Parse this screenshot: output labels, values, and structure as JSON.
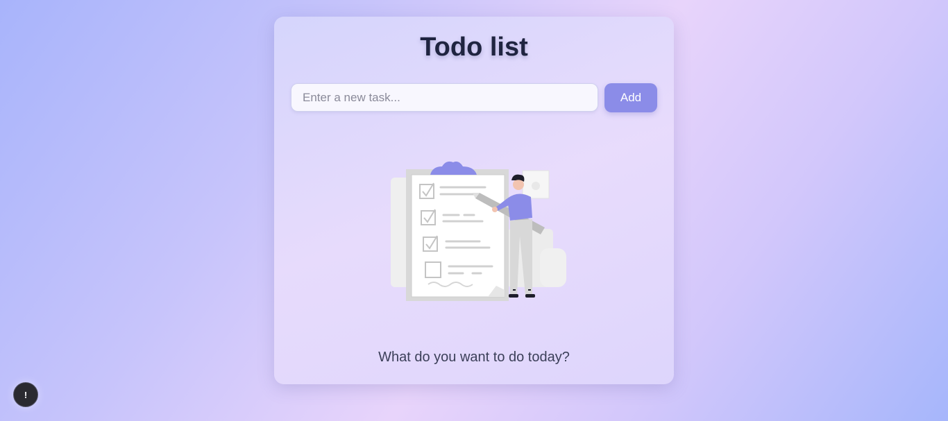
{
  "app": {
    "title": "Todo list"
  },
  "input": {
    "placeholder": "Enter a new task...",
    "value": ""
  },
  "add_button": {
    "label": "Add"
  },
  "empty_state": {
    "message": "What do you want to do today?",
    "illustration": "checklist-person-illustration"
  },
  "alert_badge": {
    "icon": "!"
  },
  "colors": {
    "accent": "#8b8ce8",
    "title": "#1f2440",
    "text": "#3b3f58"
  }
}
